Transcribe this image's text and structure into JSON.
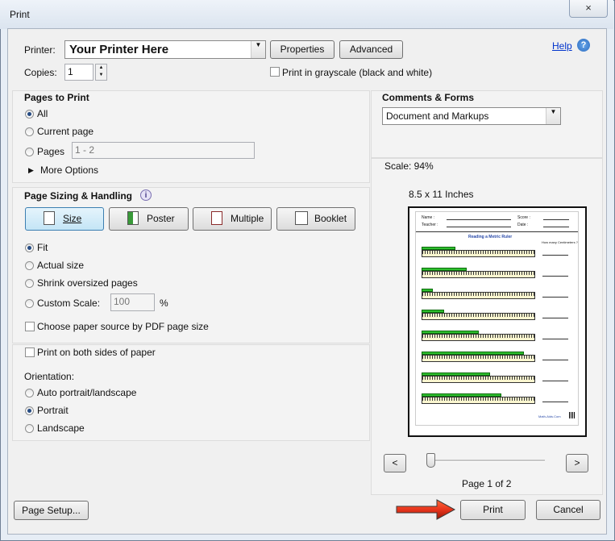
{
  "window": {
    "title": "Print",
    "close_label": "×"
  },
  "printer": {
    "label": "Printer:",
    "value": "Your Printer Here",
    "properties_label": "Properties",
    "advanced_label": "Advanced",
    "help_label": "Help",
    "copies_label": "Copies:",
    "copies_value": "1",
    "grayscale_label": "Print in grayscale (black and white)"
  },
  "pages_to_print": {
    "heading": "Pages to Print",
    "all_label": "All",
    "current_label": "Current page",
    "pages_label": "Pages",
    "pages_value": "1 - 2",
    "more_options_label": "More Options"
  },
  "comments_forms": {
    "heading": "Comments & Forms",
    "value": "Document and Markups"
  },
  "sizing": {
    "heading": "Page Sizing & Handling",
    "size_label": "Size",
    "poster_label": "Poster",
    "multiple_label": "Multiple",
    "booklet_label": "Booklet",
    "fit_label": "Fit",
    "actual_label": "Actual size",
    "shrink_label": "Shrink oversized pages",
    "custom_label": "Custom Scale:",
    "custom_value": "100",
    "percent_label": "%",
    "paper_source_label": "Choose paper source by PDF page size"
  },
  "duplex": {
    "both_sides_label": "Print on both sides of paper",
    "orientation_label": "Orientation:",
    "auto_label": "Auto portrait/landscape",
    "portrait_label": "Portrait",
    "landscape_label": "Landscape"
  },
  "preview": {
    "scale_label": "Scale:  94%",
    "paper_label": "8.5 x 11 Inches",
    "page_label": "Page 1 of 2",
    "prev_label": "<",
    "next_label": ">",
    "sheet": {
      "name_label": "Name :",
      "teacher_label": "Teacher :",
      "score_label": "Score :",
      "date_label": "Date :",
      "title": "Reading a Metric Ruler",
      "question": "How many Centimeters ?",
      "footer": "Math-Aids.Com"
    },
    "ruler_bars": [
      0.3,
      0.4,
      0.1,
      0.2,
      0.5,
      0.9,
      0.6,
      0.7
    ]
  },
  "footer": {
    "page_setup_label": "Page Setup...",
    "print_label": "Print",
    "cancel_label": "Cancel"
  },
  "colors": {
    "accent": "#254b83",
    "arrow": "#e8341c"
  }
}
